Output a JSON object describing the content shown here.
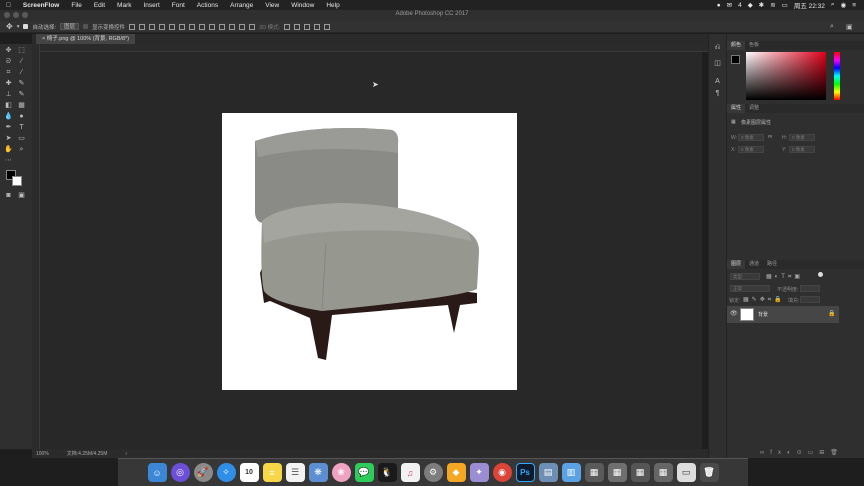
{
  "menubar": {
    "apple": "",
    "app_name": "ScreenFlow",
    "items": [
      "File",
      "Edit",
      "Mark",
      "Insert",
      "Font",
      "Actions",
      "Arrange",
      "View",
      "Window",
      "Help"
    ],
    "status_count": "4",
    "clock": "周五 22:32"
  },
  "photoshop": {
    "window_title": "Adobe Photoshop CC 2017",
    "options": {
      "auto_select_label": "自动选择:",
      "auto_select_value": "图层",
      "show_transform_label": "显示变换控件"
    },
    "document_tab": "椅子.png @ 100% (背景, RGB/8*)",
    "status": {
      "zoom": "100%",
      "doc_size": "文档:4.25M/4.25M"
    }
  },
  "panels": {
    "color_tabs": [
      "颜色",
      "色板"
    ],
    "properties_tabs": [
      "属性",
      "调整"
    ],
    "properties_title": "像素图层属性",
    "properties_fields": {
      "w_label": "W:",
      "w_value": "0 像素",
      "h_label": "H:",
      "h_value": "0 像素",
      "x_label": "X:",
      "x_value": "0 像素",
      "y_label": "Y:",
      "y_value": "0 像素"
    },
    "layers_tabs": [
      "图层",
      "通道",
      "路径"
    ],
    "layers_kind": "类型",
    "layers_blend": "正常",
    "layers_opacity_label": "不透明度:",
    "layers_lock_label": "锁定:",
    "layers_fill_label": "填充:",
    "layer_name": "背景"
  },
  "dock": {
    "icons": [
      "finder-icon",
      "siri-icon",
      "launchpad-icon",
      "safari-icon",
      "calendar-icon",
      "notes-icon",
      "reminders-icon",
      "photos-icon",
      "wechat-icon",
      "qq-icon",
      "itunes-icon",
      "system-preferences-icon",
      "sketch-icon",
      "screenflow-icon",
      "chrome-icon",
      "photoshop-icon",
      "preview-icon",
      "downloads-icon",
      "screenshots-icon",
      "trash-icon"
    ],
    "calendar_day": "10",
    "ps_label": "Ps"
  },
  "colors": {
    "accent_red": "#e0001a",
    "canvas_bg": "#282828",
    "panel_bg": "#2f2f2f"
  }
}
